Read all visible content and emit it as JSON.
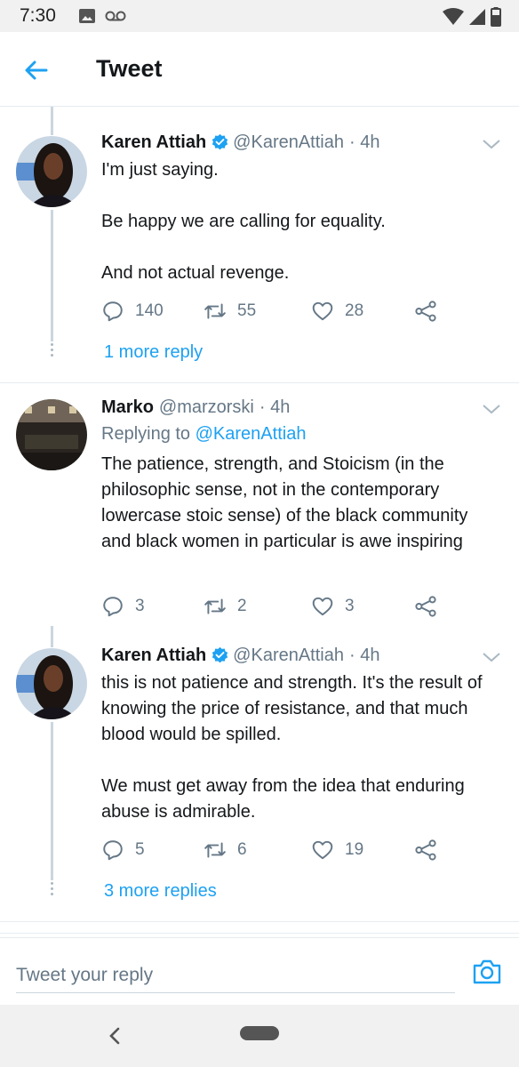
{
  "status_bar": {
    "time": "7:30"
  },
  "header": {
    "title": "Tweet"
  },
  "tweets": [
    {
      "name": "Karen Attiah",
      "verified": true,
      "handle": "@KarenAttiah",
      "time": "· 4h",
      "text": "I'm just saying.\n\nBe happy we are calling for equality.\n\nAnd not actual revenge.",
      "replies": "140",
      "retweets": "55",
      "likes": "28",
      "more_replies": "1 more reply"
    },
    {
      "name": "Marko",
      "verified": false,
      "handle": "@marzorski",
      "time": "· 4h",
      "replying_prefix": "Replying to",
      "replying_to": "@KarenAttiah",
      "text": "The patience, strength, and Stoicism (in the philosophic sense, not in the contemporary lowercase stoic sense) of the black community and black women in particular is awe inspiring",
      "replies": "3",
      "retweets": "2",
      "likes": "3"
    },
    {
      "name": "Karen Attiah",
      "verified": true,
      "handle": "@KarenAttiah",
      "time": "· 4h",
      "text": "this is not patience and strength. It's the result of knowing the price of resistance, and that much blood would be spilled.\n\nWe must get away from the idea that enduring abuse is admirable.",
      "replies": "5",
      "retweets": "6",
      "likes": "19",
      "more_replies": "3 more replies"
    }
  ],
  "reply_bar": {
    "placeholder": "Tweet your reply"
  },
  "colors": {
    "accent": "#1da1f2",
    "secondary_text": "#657786",
    "primary_text": "#14171a",
    "thread_line": "#ccd6dd"
  },
  "icons": [
    "back-arrow-icon",
    "reply-icon",
    "retweet-icon",
    "like-icon",
    "share-icon",
    "chevron-down-icon",
    "verified-badge-icon",
    "camera-icon"
  ]
}
